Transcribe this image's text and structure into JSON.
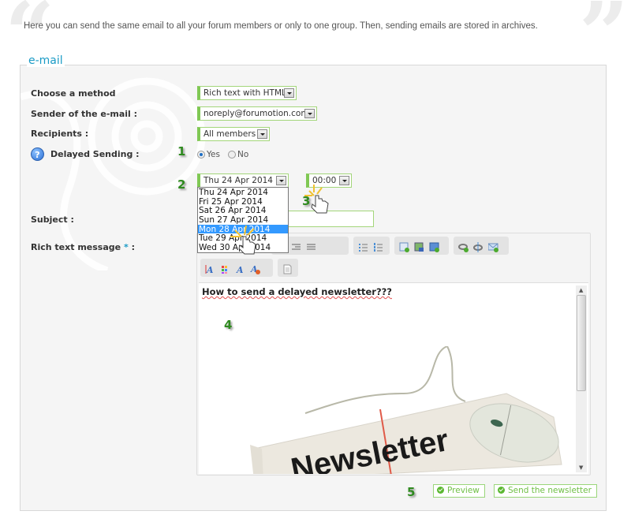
{
  "intro": {
    "text": "Here you can send the same email to all your forum members or only to one group. Then, sending emails are stored in archives."
  },
  "fieldset": {
    "legend": "e-mail"
  },
  "form": {
    "method": {
      "label": "Choose a method",
      "value": "Rich text with HTML"
    },
    "sender": {
      "label": "Sender of the e-mail :",
      "value": "noreply@forumotion.com"
    },
    "recipients": {
      "label": "Recipients :",
      "value": "All members"
    },
    "delayed": {
      "label": "Delayed Sending :",
      "options": [
        {
          "label": "Yes",
          "checked": true
        },
        {
          "label": "No",
          "checked": false
        }
      ]
    },
    "date": {
      "value": "Thu 24 Apr 2014",
      "options": [
        "Thu 24 Apr 2014",
        "Fri 25 Apr 2014",
        "Sat 26 Apr 2014",
        "Sun 27 Apr 2014",
        "Mon 28 Apr 2014",
        "Tue 29 Apr 2014",
        "Wed 30 Apr 2014"
      ],
      "highlighted": "Mon 28 Apr 2014"
    },
    "time": {
      "value": "00:00"
    },
    "subject": {
      "label": "Subject :",
      "value": ""
    },
    "message": {
      "label": "Rich text message",
      "required_mark": "*",
      "label_suffix": ":",
      "content_title": "How to send a delayed newsletter???",
      "image_text": "Newsletter"
    }
  },
  "toolbar": {
    "row1": [
      [
        "align-center-icon",
        "align-right-icon",
        "align-justify-icon"
      ],
      [
        "bullet-list-icon",
        "numbered-list-icon"
      ],
      [
        "insert-table-icon",
        "insert-image-icon",
        "insert-media-icon"
      ],
      [
        "insert-link-icon",
        "unlink-icon",
        "insert-email-icon"
      ]
    ],
    "row2": [
      [
        "font-size-icon",
        "font-color-icon",
        "font-family-icon",
        "remove-format-icon"
      ],
      [
        "source-document-icon"
      ]
    ]
  },
  "buttons": {
    "preview": "Preview",
    "send": "Send the newsletter"
  },
  "steps": [
    "1",
    "2",
    "3",
    "4",
    "5"
  ],
  "colors": {
    "accent_green": "#80c854",
    "legend_blue": "#1a9bc6",
    "step_green": "#2f8a1f",
    "selection_blue": "#3399ff"
  }
}
